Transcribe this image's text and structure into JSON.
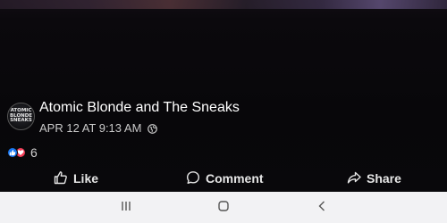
{
  "post": {
    "page_name": "Atomic Blonde and The Sneaks",
    "timestamp": "APR 12 AT 9:13 AM",
    "privacy_icon": "globe-icon",
    "avatar_text": [
      "ATOMIC",
      "BLONDE",
      "SNEAKS"
    ]
  },
  "reactions": {
    "icons": [
      "like-reaction-icon",
      "love-reaction-icon"
    ],
    "count": "6"
  },
  "actions": {
    "like_label": "Like",
    "comment_label": "Comment",
    "share_label": "Share"
  },
  "nav": {
    "icons": [
      "recent-apps-icon",
      "home-icon",
      "back-icon"
    ]
  },
  "colors": {
    "background": "#0a0a0c",
    "like_blue": "#1877f2",
    "love_red": "#f33e58",
    "nav_bar": "#f2f2f4"
  }
}
